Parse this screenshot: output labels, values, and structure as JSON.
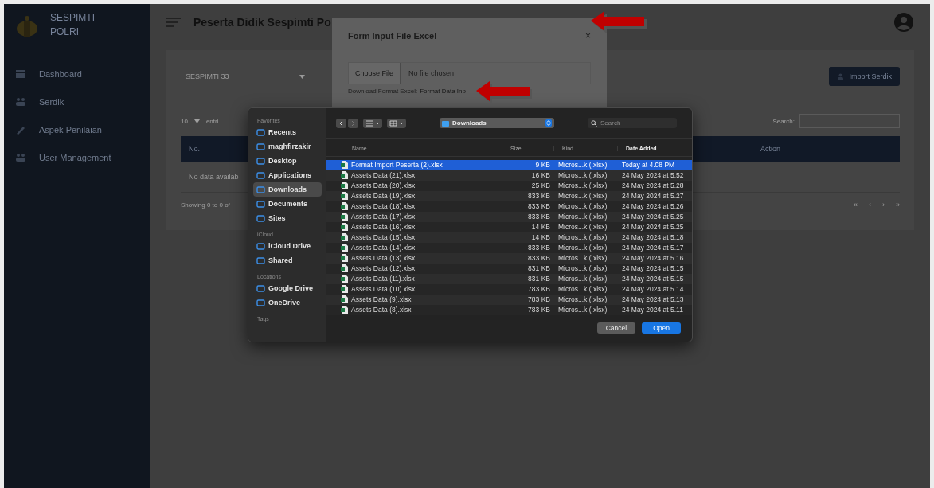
{
  "sidebar": {
    "brand_lines": [
      "SESPIMTI",
      "POLRI"
    ],
    "items": [
      {
        "label": "Dashboard"
      },
      {
        "label": "Serdik"
      },
      {
        "label": "Aspek Penilaian"
      },
      {
        "label": "User Management"
      }
    ]
  },
  "header": {
    "title": "Peserta Didik Sespimti Po"
  },
  "page": {
    "batch_select": "SESPIMTI 33",
    "import_button": "Import Serdik",
    "page_size": "10",
    "entries_label": "entri",
    "search_label": "Search:",
    "table": {
      "columns": [
        "No.",
        "Action"
      ],
      "empty_message": "No data availab"
    },
    "info": "Showing 0 to 0 of",
    "pagination": [
      "«",
      "‹",
      "›",
      "»"
    ]
  },
  "modal": {
    "title": "Form Input File Excel",
    "close": "×",
    "file_button": "Choose File",
    "file_status": "No file chosen",
    "download_label": "Download Format Excel:",
    "download_link": "Format Data Inp"
  },
  "file_dialog": {
    "sidebar_sections": [
      {
        "heading": "Favorites",
        "items": [
          {
            "label": "Recents",
            "selected": false
          },
          {
            "label": "maghfirzakir",
            "selected": false
          },
          {
            "label": "Desktop",
            "selected": false
          },
          {
            "label": "Applications",
            "selected": false
          },
          {
            "label": "Downloads",
            "selected": true
          },
          {
            "label": "Documents",
            "selected": false
          },
          {
            "label": "Sites",
            "selected": false
          }
        ]
      },
      {
        "heading": "iCloud",
        "items": [
          {
            "label": "iCloud Drive",
            "selected": false
          },
          {
            "label": "Shared",
            "selected": false
          }
        ]
      },
      {
        "heading": "Locations",
        "items": [
          {
            "label": "Google Drive",
            "selected": false
          },
          {
            "label": "OneDrive",
            "selected": false
          }
        ]
      },
      {
        "heading": "Tags"
      }
    ],
    "location": "Downloads",
    "search_placeholder": "Search",
    "columns": [
      "Name",
      "Size",
      "Kind",
      "Date Added"
    ],
    "files": [
      {
        "name": "Format Import Peserta (2).xlsx",
        "size": "9 KB",
        "kind": "Micros...k (.xlsx)",
        "date": "Today at 4.08 PM",
        "selected": true
      },
      {
        "name": "Assets Data (21).xlsx",
        "size": "16 KB",
        "kind": "Micros...k (.xlsx)",
        "date": "24 May 2024 at 5.52",
        "selected": false
      },
      {
        "name": "Assets Data (20).xlsx",
        "size": "25 KB",
        "kind": "Micros...k (.xlsx)",
        "date": "24 May 2024 at 5.28",
        "selected": false
      },
      {
        "name": "Assets Data (19).xlsx",
        "size": "833 KB",
        "kind": "Micros...k (.xlsx)",
        "date": "24 May 2024 at 5.27",
        "selected": false
      },
      {
        "name": "Assets Data (18).xlsx",
        "size": "833 KB",
        "kind": "Micros...k (.xlsx)",
        "date": "24 May 2024 at 5.26",
        "selected": false
      },
      {
        "name": "Assets Data (17).xlsx",
        "size": "833 KB",
        "kind": "Micros...k (.xlsx)",
        "date": "24 May 2024 at 5.25",
        "selected": false
      },
      {
        "name": "Assets Data (16).xlsx",
        "size": "14 KB",
        "kind": "Micros...k (.xlsx)",
        "date": "24 May 2024 at 5.25",
        "selected": false
      },
      {
        "name": "Assets Data (15).xlsx",
        "size": "14 KB",
        "kind": "Micros...k (.xlsx)",
        "date": "24 May 2024 at 5.18",
        "selected": false
      },
      {
        "name": "Assets Data (14).xlsx",
        "size": "833 KB",
        "kind": "Micros...k (.xlsx)",
        "date": "24 May 2024 at 5.17",
        "selected": false
      },
      {
        "name": "Assets Data (13).xlsx",
        "size": "833 KB",
        "kind": "Micros...k (.xlsx)",
        "date": "24 May 2024 at 5.16",
        "selected": false
      },
      {
        "name": "Assets Data (12).xlsx",
        "size": "831 KB",
        "kind": "Micros...k (.xlsx)",
        "date": "24 May 2024 at 5.15",
        "selected": false
      },
      {
        "name": "Assets Data (11).xlsx",
        "size": "831 KB",
        "kind": "Micros...k (.xlsx)",
        "date": "24 May 2024 at 5.15",
        "selected": false
      },
      {
        "name": "Assets Data (10).xlsx",
        "size": "783 KB",
        "kind": "Micros...k (.xlsx)",
        "date": "24 May 2024 at 5.14",
        "selected": false
      },
      {
        "name": "Assets Data (9).xlsx",
        "size": "783 KB",
        "kind": "Micros...k (.xlsx)",
        "date": "24 May 2024 at 5.13",
        "selected": false
      },
      {
        "name": "Assets Data (8).xlsx",
        "size": "783 KB",
        "kind": "Micros...k (.xlsx)",
        "date": "24 May 2024 at 5.11",
        "selected": false
      }
    ],
    "buttons": [
      "Cancel",
      "Open"
    ]
  }
}
